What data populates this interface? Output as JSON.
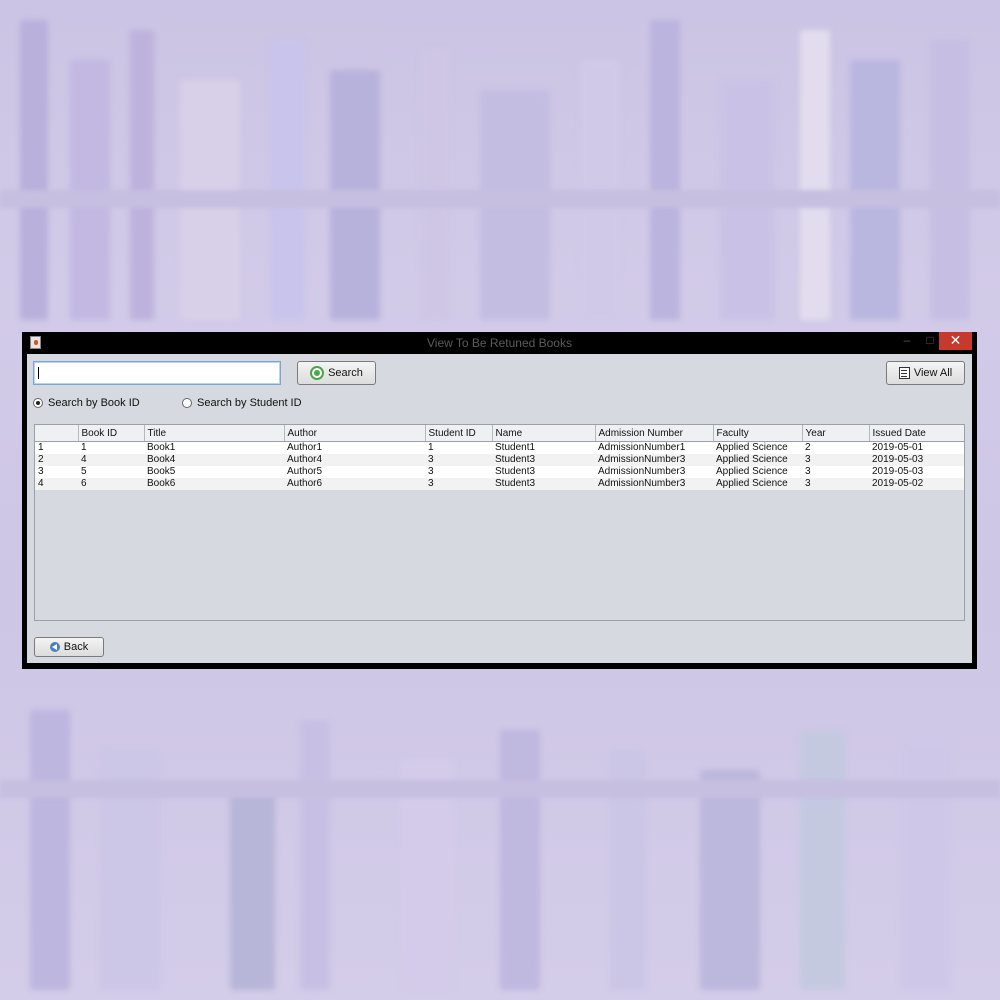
{
  "window": {
    "title": "View To Be Retuned Books"
  },
  "search": {
    "value": "",
    "button_label": "Search"
  },
  "view_all_label": "View All",
  "radios": {
    "book_id_label": "Search by Book ID",
    "student_id_label": "Search by Student ID",
    "selected": "book_id"
  },
  "table": {
    "columns": [
      "",
      "Book ID",
      "Title",
      "Author",
      "Student ID",
      "Name",
      "Admission Number",
      "Faculty",
      "Year",
      "Issued Date"
    ],
    "rows": [
      [
        "1",
        "1",
        "Book1",
        "Author1",
        "1",
        "Student1",
        "AdmissionNumber1",
        "Applied Science",
        "2",
        "2019-05-01"
      ],
      [
        "2",
        "4",
        "Book4",
        "Author4",
        "3",
        "Student3",
        "AdmissionNumber3",
        "Applied Science",
        "3",
        "2019-05-03"
      ],
      [
        "3",
        "5",
        "Book5",
        "Author5",
        "3",
        "Student3",
        "AdmissionNumber3",
        "Applied Science",
        "3",
        "2019-05-03"
      ],
      [
        "4",
        "6",
        "Book6",
        "Author6",
        "3",
        "Student3",
        "AdmissionNumber3",
        "Applied Science",
        "3",
        "2019-05-02"
      ]
    ]
  },
  "back_label": "Back",
  "icons": {
    "search": "search-icon",
    "view_all": "list-icon",
    "back": "back-arrow-icon",
    "app": "java-app-icon"
  },
  "colors": {
    "close_button": "#c7392c",
    "window_bg": "#d6d9df"
  }
}
